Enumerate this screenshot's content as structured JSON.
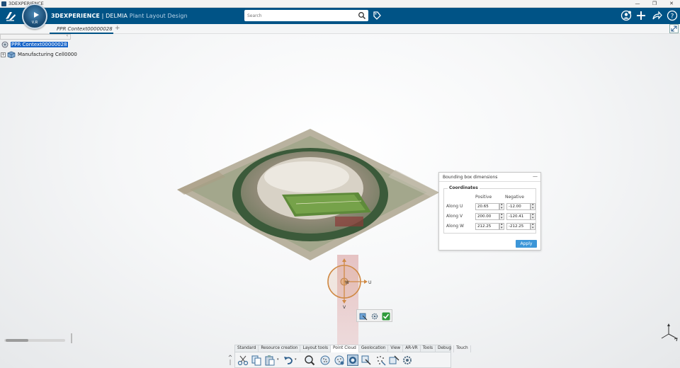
{
  "window": {
    "title": "3DEXPERIENCE"
  },
  "header": {
    "brand_bold": "3DEXPERIENCE",
    "brand_sep": " | ",
    "brand_product": "DELMIA",
    "brand_app": "Plant Layout Design",
    "compass_label": "V,R",
    "search_placeholder": "Search"
  },
  "tabs": [
    {
      "label": "PPR Context00000028",
      "active": true
    }
  ],
  "tab_add": "+",
  "tree": [
    {
      "label": "PPR Context00000028",
      "selected": true
    },
    {
      "label": "Manufacturing Cell0000",
      "selected": false
    }
  ],
  "manipulator": {
    "axis_w": "W",
    "axis_u": "U",
    "axis_v": "V"
  },
  "bbox_panel": {
    "title": "Bounding box dimensions",
    "minimize": "—",
    "group": "Coordinates",
    "col_positive": "Positive",
    "col_negative": "Negative",
    "rows": [
      {
        "label": "Along U",
        "positive": "20.65",
        "negative": "-12.00"
      },
      {
        "label": "Along V",
        "positive": "200.00",
        "negative": "-120.41"
      },
      {
        "label": "Along W",
        "positive": "212.25",
        "negative": "-212.25"
      }
    ],
    "apply_label": "Apply"
  },
  "action_bar": {
    "tabs": [
      {
        "label": "Standard",
        "active": false
      },
      {
        "label": "Resource creation",
        "active": false
      },
      {
        "label": "Layout tools",
        "active": false
      },
      {
        "label": "Point Cloud",
        "active": true
      },
      {
        "label": "Geolocation",
        "active": false
      },
      {
        "label": "View",
        "active": false
      },
      {
        "label": "AR-VR",
        "active": false
      },
      {
        "label": "Tools",
        "active": false
      },
      {
        "label": "Debug",
        "active": false
      },
      {
        "label": "Touch",
        "active": false
      }
    ],
    "icons": [
      "cut-icon",
      "copy-icon",
      "paste-icon",
      "undo-icon",
      "zoom-fit-icon",
      "point-cloud-display-icon",
      "point-cloud-filter-icon",
      "point-cloud-section-icon",
      "point-cloud-edit-icon",
      "point-cloud-sample-icon",
      "point-cloud-measure-icon",
      "point-cloud-settings-icon"
    ]
  },
  "colors": {
    "header": "#005386",
    "apply": "#3c96d8",
    "selection": "#1a66c9",
    "manipulator": "#d08a45"
  }
}
